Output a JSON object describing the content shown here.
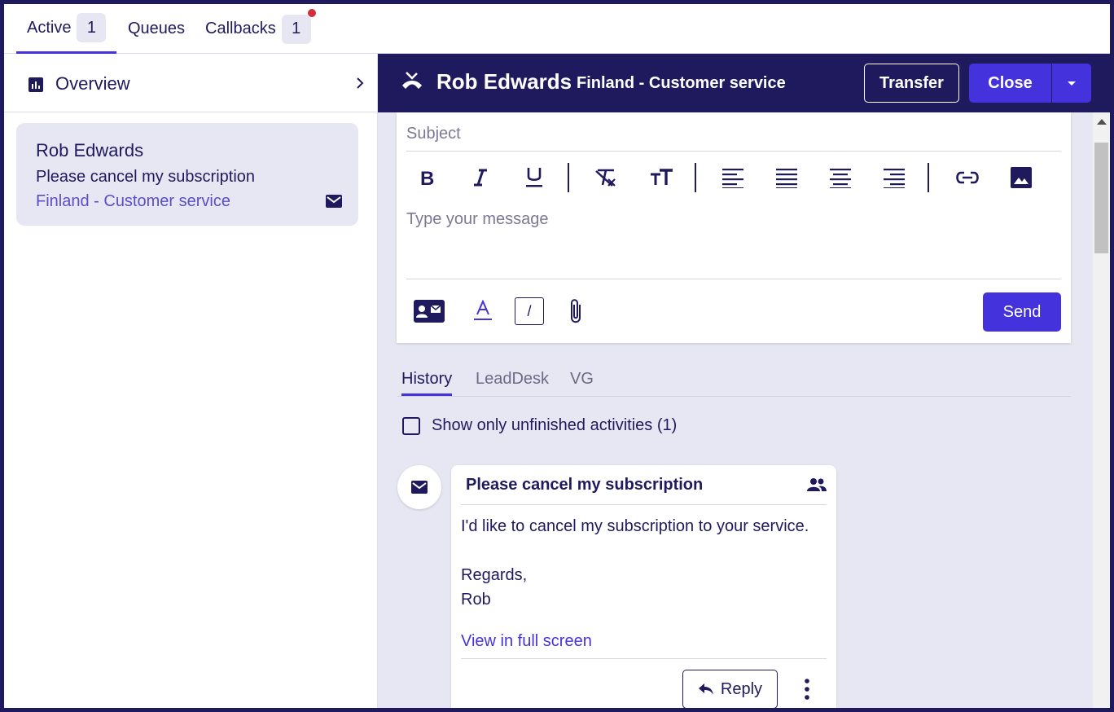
{
  "top_tabs": [
    {
      "label": "Active",
      "count": "1"
    },
    {
      "label": "Queues"
    },
    {
      "label": "Callbacks",
      "count": "1"
    }
  ],
  "sidebar": {
    "overview_label": "Overview",
    "conversation": {
      "name": "Rob Edwards",
      "subject": "Please cancel my subscription",
      "queue": "Finland - Customer service",
      "icon": "mail-icon"
    }
  },
  "header": {
    "contact_name": "Rob Edwards",
    "queue": "Finland - Customer service",
    "transfer_label": "Transfer",
    "close_label": "Close"
  },
  "composer": {
    "subject_placeholder": "Subject",
    "message_placeholder": "Type your message",
    "send_label": "Send",
    "slash_label": "/",
    "toolbar": [
      "bold-icon",
      "italic-icon",
      "underline-icon",
      "clear-format-icon",
      "text-size-icon",
      "align-left-icon",
      "justify-icon",
      "align-center-icon",
      "align-right-icon",
      "link-icon",
      "image-icon"
    ],
    "bottom_tools": [
      "contact-card-icon",
      "text-color-icon",
      "slash-command",
      "attachment-icon"
    ]
  },
  "history": {
    "tabs": [
      "History",
      "LeadDesk",
      "VG"
    ],
    "active_tab": "History",
    "unfinished_label": "Show only unfinished activities (1)",
    "activity": {
      "title": "Please cancel my subscription",
      "body_line1": "I'd like to cancel my subscription to your service.",
      "body_line2": "Regards,",
      "body_line3": "Rob",
      "view_full_label": "View in full screen",
      "reply_label": "Reply"
    }
  },
  "colors": {
    "navy": "#1f1a5e",
    "accent": "#4433dd",
    "light_bg": "#e6e7f2",
    "notification": "#d22f3c"
  }
}
